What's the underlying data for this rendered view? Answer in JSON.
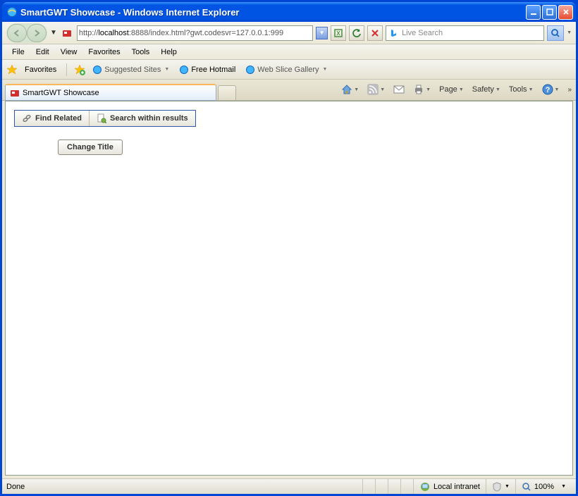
{
  "window": {
    "title": "SmartGWT Showcase - Windows Internet Explorer"
  },
  "nav": {
    "url_proto": "http://",
    "url_host": "localhost",
    "url_rest": ":8888/index.html?gwt.codesvr=127.0.0.1:999"
  },
  "menu": {
    "file": "File",
    "edit": "Edit",
    "view": "View",
    "favorites": "Favorites",
    "tools": "Tools",
    "help": "Help"
  },
  "favbar": {
    "favorites": "Favorites",
    "suggested": "Suggested Sites",
    "hotmail": "Free Hotmail",
    "webslice": "Web Slice Gallery"
  },
  "tab": {
    "title": "SmartGWT Showcase"
  },
  "cmdbar": {
    "page": "Page",
    "safety": "Safety",
    "tools": "Tools"
  },
  "search": {
    "placeholder": "Live Search"
  },
  "content": {
    "find_related": "Find Related",
    "search_within": "Search within results",
    "change_title": "Change Title"
  },
  "status": {
    "done": "Done",
    "zone": "Local intranet",
    "zoom": "100%"
  }
}
